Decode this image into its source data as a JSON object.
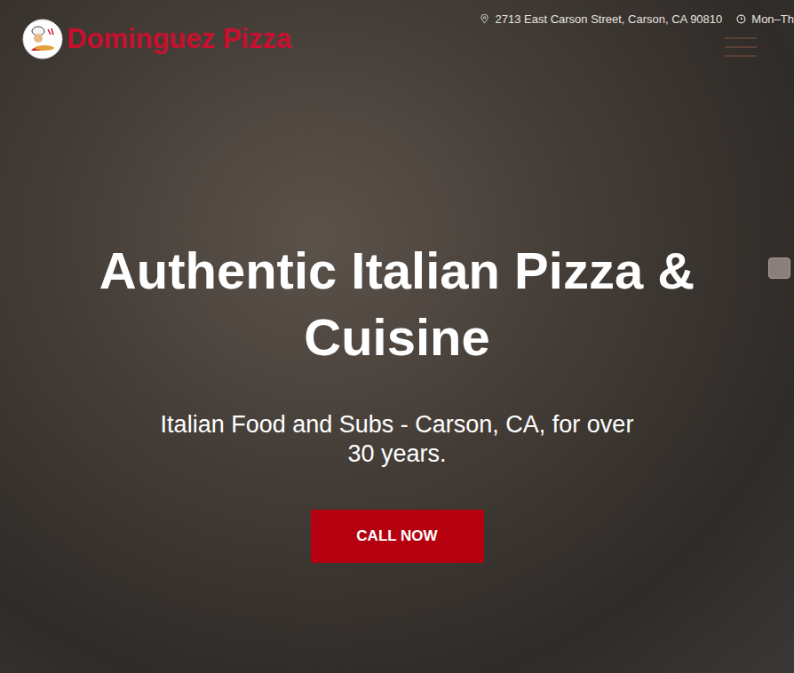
{
  "header": {
    "brand": "Dominguez Pizza",
    "address": "2713 East Carson Street, Carson, CA 90810",
    "hours": "Mon–Th"
  },
  "hero": {
    "title": "Authentic Italian Pizza & Cuisine",
    "subtitle": "Italian Food and Subs - Carson, CA, for over 30 years.",
    "button": "CALL NOW"
  }
}
